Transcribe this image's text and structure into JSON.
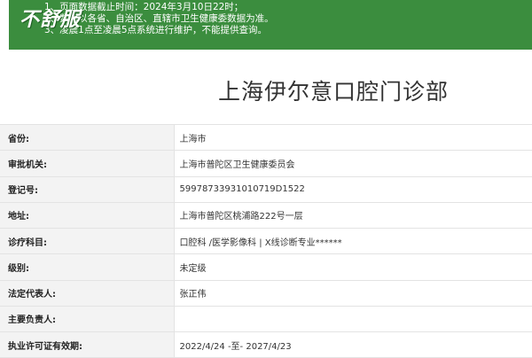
{
  "notice": {
    "watermark": "不舒服",
    "lines": [
      "1、页面数据截止时间：2024年3月10日22时；",
      "2、数据以各省、自治区、直辖市卫生健康委数据为准。",
      "3、凌晨1点至凌晨5点系统进行维护，不能提供查询。"
    ]
  },
  "title": "上海伊尔意口腔门诊部",
  "rows": [
    {
      "label": "省份:",
      "value": "上海市"
    },
    {
      "label": "审批机关:",
      "value": "上海市普陀区卫生健康委员会"
    },
    {
      "label": "登记号:",
      "value": "59978733931010719D1522"
    },
    {
      "label": "地址:",
      "value": "上海市普陀区桃浦路222号一层"
    },
    {
      "label": "诊疗科目:",
      "value": "口腔科 /医学影像科 | X线诊断专业******"
    },
    {
      "label": "级别:",
      "value": "未定级"
    },
    {
      "label": "法定代表人:",
      "value": "张正伟"
    },
    {
      "label": "主要负责人:",
      "value": ""
    },
    {
      "label": "执业许可证有效期:",
      "value": "2022/4/24 -至- 2027/4/23"
    }
  ],
  "colors": {
    "notice_bg": "#3b8d3e",
    "label_bg": "#f3f3f3"
  }
}
